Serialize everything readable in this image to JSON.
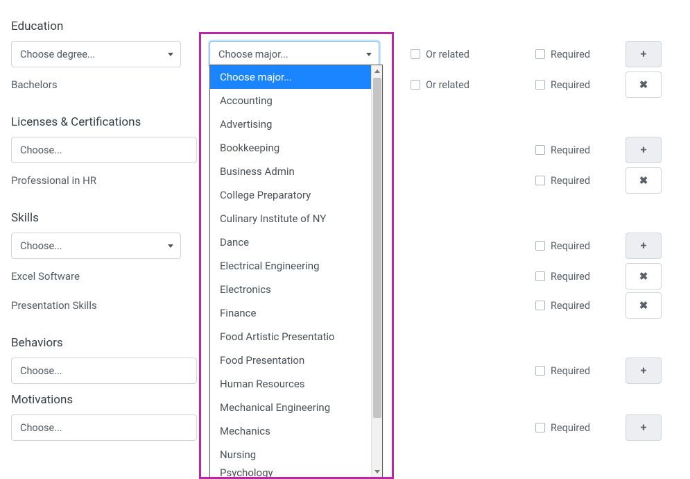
{
  "education": {
    "title": "Education",
    "degree_placeholder": "Choose degree...",
    "major_placeholder": "Choose major...",
    "or_related": "Or related",
    "required": "Required",
    "row2_label": "Bachelors"
  },
  "licenses": {
    "title": "Licenses & Certifications",
    "placeholder": "Choose...",
    "required": "Required",
    "row2_label": "Professional in HR"
  },
  "skills": {
    "title": "Skills",
    "placeholder": "Choose...",
    "required": "Required",
    "item1": "Excel Software",
    "item2": "Presentation Skills"
  },
  "behaviors": {
    "title": "Behaviors",
    "placeholder": "Choose...",
    "required": "Required"
  },
  "motivations": {
    "title": "Motivations",
    "placeholder": "Choose...",
    "required": "Required"
  },
  "dropdown": {
    "options": [
      "Choose major...",
      "Accounting",
      "Advertising",
      "Bookkeeping",
      "Business Admin",
      "College Preparatory",
      "Culinary Institute of NY",
      "Dance",
      "Electrical Engineering",
      "Electronics",
      "Finance",
      "Food Artistic Presentatio",
      "Food Presentation",
      "Human Resources",
      "Mechanical Engineering",
      "Mechanics",
      "Nursing",
      "Psychology"
    ]
  },
  "icons": {
    "plus": "+",
    "x": "✖"
  }
}
